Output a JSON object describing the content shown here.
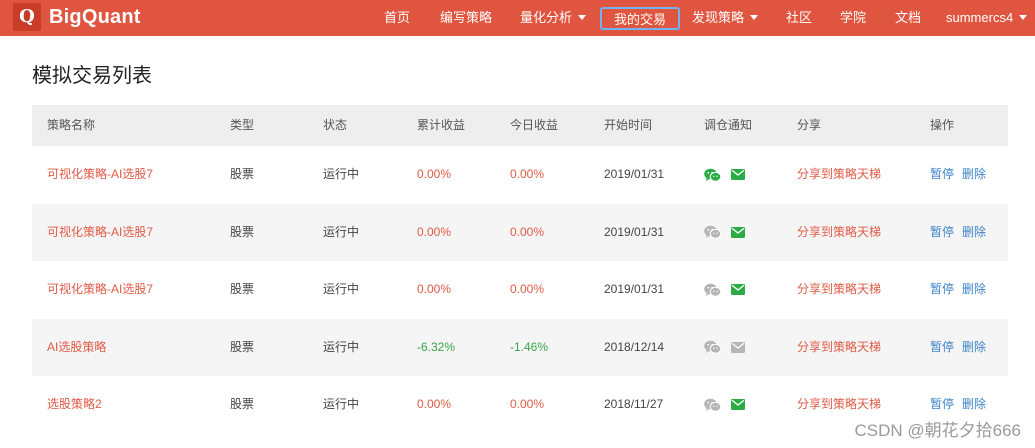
{
  "brand": {
    "logo_letter": "Q",
    "name": "BigQuant"
  },
  "nav": {
    "items": [
      {
        "label": "首页"
      },
      {
        "label": "编写策略"
      },
      {
        "label": "量化分析"
      },
      {
        "label": "我的交易"
      },
      {
        "label": "发现策略"
      },
      {
        "label": "社区"
      },
      {
        "label": "学院"
      },
      {
        "label": "文档"
      },
      {
        "label": "summercs4"
      }
    ]
  },
  "page": {
    "title": "模拟交易列表"
  },
  "table": {
    "headers": [
      "策略名称",
      "类型",
      "状态",
      "累计收益",
      "今日收益",
      "开始时间",
      "调仓通知",
      "分享",
      "操作"
    ],
    "rows": [
      {
        "name": "可视化策略-AI选股7",
        "type": "股票",
        "status": "运行中",
        "cum_return": "0.00%",
        "day_return": "0.00%",
        "start": "2019/01/31",
        "share": "分享到策略天梯",
        "pause": "暂停",
        "delete": "删除"
      },
      {
        "name": "可视化策略-AI选股7",
        "type": "股票",
        "status": "运行中",
        "cum_return": "0.00%",
        "day_return": "0.00%",
        "start": "2019/01/31",
        "share": "分享到策略天梯",
        "pause": "暂停",
        "delete": "删除"
      },
      {
        "name": "可视化策略-AI选股7",
        "type": "股票",
        "status": "运行中",
        "cum_return": "0.00%",
        "day_return": "0.00%",
        "start": "2019/01/31",
        "share": "分享到策略天梯",
        "pause": "暂停",
        "delete": "删除"
      },
      {
        "name": "AI选股策略",
        "type": "股票",
        "status": "运行中",
        "cum_return": "-6.32%",
        "day_return": "-1.46%",
        "start": "2018/12/14",
        "share": "分享到策略天梯",
        "pause": "暂停",
        "delete": "删除"
      },
      {
        "name": "选股策略2",
        "type": "股票",
        "status": "运行中",
        "cum_return": "0.00%",
        "day_return": "0.00%",
        "start": "2018/11/27",
        "share": "分享到策略天梯",
        "pause": "暂停",
        "delete": "删除"
      }
    ]
  },
  "watermark": "CSDN @朝花夕拾666",
  "colors": {
    "brand": "#e0553f",
    "link_red": "#e05a45",
    "positive_green": "#3aa34a",
    "action_blue": "#3d84c8",
    "icon_active": "#2bab43",
    "icon_inactive": "#b5b5b5"
  }
}
